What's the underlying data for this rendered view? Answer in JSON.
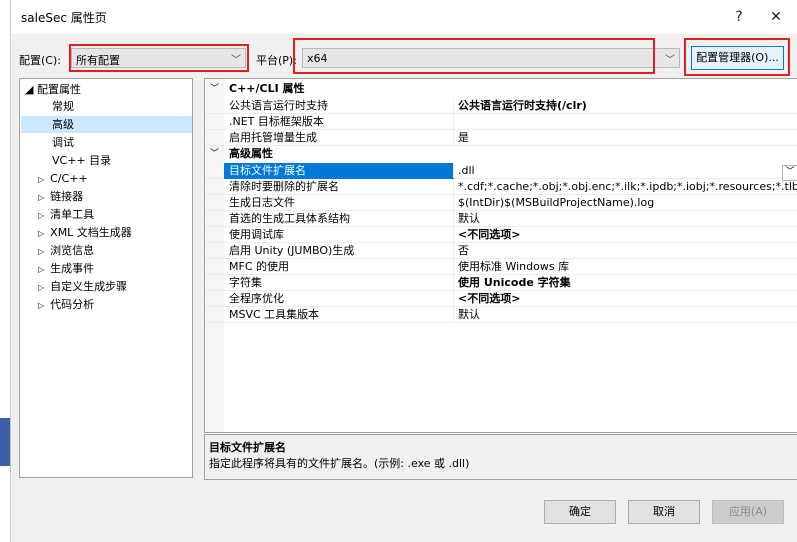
{
  "window": {
    "title": "saleSec 属性页",
    "help": "?",
    "close": "✕"
  },
  "toolbar": {
    "config_label": "配置(C):",
    "config_value": "所有配置",
    "platform_label": "平台(P):",
    "platform_value": "x64",
    "manager_button": "配置管理器(O)..."
  },
  "tree": {
    "root": "配置属性",
    "items": [
      {
        "label": "常规",
        "expander": ""
      },
      {
        "label": "高级",
        "expander": "",
        "selected": true
      },
      {
        "label": "调试",
        "expander": ""
      },
      {
        "label": "VC++ 目录",
        "expander": ""
      },
      {
        "label": "C/C++",
        "expander": "▷"
      },
      {
        "label": "链接器",
        "expander": "▷"
      },
      {
        "label": "清单工具",
        "expander": "▷"
      },
      {
        "label": "XML 文档生成器",
        "expander": "▷"
      },
      {
        "label": "浏览信息",
        "expander": "▷"
      },
      {
        "label": "生成事件",
        "expander": "▷"
      },
      {
        "label": "自定义生成步骤",
        "expander": "▷"
      },
      {
        "label": "代码分析",
        "expander": "▷"
      }
    ]
  },
  "grid": {
    "sections": [
      {
        "title": "C++/CLI 属性",
        "rows": [
          {
            "name": "公共语言运行时支持",
            "value": "公共语言运行时支持(/clr)",
            "bold": true
          },
          {
            "name": ".NET 目标框架版本",
            "value": ""
          },
          {
            "name": "启用托管增量生成",
            "value": "是"
          }
        ]
      },
      {
        "title": "高级属性",
        "rows": [
          {
            "name": "目标文件扩展名",
            "value": ".dll",
            "selected": true
          },
          {
            "name": "清除时要删除的扩展名",
            "value": "*.cdf;*.cache;*.obj;*.obj.enc;*.ilk;*.ipdb;*.iobj;*.resources;*.tlb;*.tli;*.t"
          },
          {
            "name": "生成日志文件",
            "value": "$(IntDir)$(MSBuildProjectName).log"
          },
          {
            "name": "首选的生成工具体系结构",
            "value": "默认"
          },
          {
            "name": "使用调试库",
            "value": "<不同选项>",
            "bold": true
          },
          {
            "name": "启用 Unity (JUMBO)生成",
            "value": "否"
          },
          {
            "name": "MFC 的使用",
            "value": "使用标准 Windows 库"
          },
          {
            "name": "字符集",
            "value": "使用 Unicode 字符集",
            "bold": true
          },
          {
            "name": "全程序优化",
            "value": "<不同选项>",
            "bold": true
          },
          {
            "name": "MSVC 工具集版本",
            "value": "默认"
          }
        ]
      }
    ]
  },
  "description": {
    "title": "目标文件扩展名",
    "text": "指定此程序将具有的文件扩展名。(示例: .exe 或 .dll)"
  },
  "footer": {
    "ok": "确定",
    "cancel": "取消",
    "apply": "应用(A)"
  },
  "colors": {
    "highlight": "#e02020",
    "selection": "#0078d7"
  }
}
